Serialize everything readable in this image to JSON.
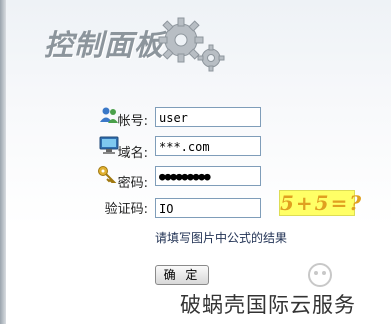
{
  "header": {
    "title": "控制面板"
  },
  "form": {
    "account_label": "帐号:",
    "account_value": "user",
    "domain_label": "域名:",
    "domain_value": "***.com",
    "password_label": "密码:",
    "password_value": "●●●●●●●●●",
    "captcha_label": "验证码:",
    "captcha_value": "IO",
    "captcha_image_text": "5+5=?",
    "hint": "请填写图片中公式的结果",
    "submit_label": "确 定"
  },
  "watermark": {
    "text": "破蜗壳国际云服务"
  }
}
